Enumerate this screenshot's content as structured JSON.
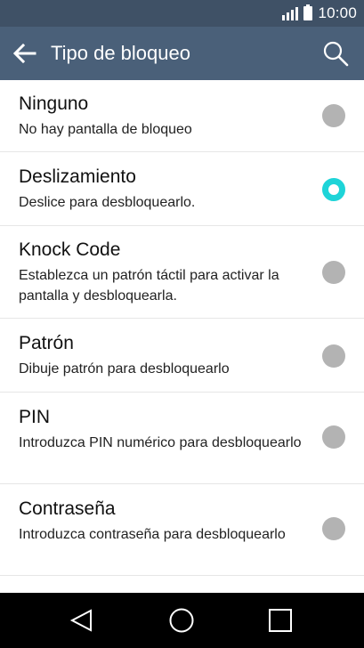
{
  "status_bar": {
    "time": "10:00",
    "icons": [
      "signal-icon",
      "battery-icon"
    ]
  },
  "app_bar": {
    "title": "Tipo de bloqueo",
    "back_icon": "arrow-left-icon",
    "search_icon": "search-icon"
  },
  "options": [
    {
      "title": "Ninguno",
      "subtitle": "No hay pantalla de bloqueo",
      "selected": false
    },
    {
      "title": "Deslizamiento",
      "subtitle": "Deslice para desbloquearlo.",
      "selected": true
    },
    {
      "title": "Knock Code",
      "subtitle": "Establezca un patrón táctil para activar la pantalla y desbloquearla.",
      "selected": false
    },
    {
      "title": "Patrón",
      "subtitle": "Dibuje patrón para desbloquearlo",
      "selected": false
    },
    {
      "title": "PIN",
      "subtitle": "Introduzca PIN numérico para desbloquearlo",
      "selected": false
    },
    {
      "title": "Contraseña",
      "subtitle": "Introduzca contraseña para desbloquearlo",
      "selected": false
    }
  ],
  "nav_bar": {
    "icons": [
      "back-triangle-icon",
      "home-circle-icon",
      "recents-square-icon"
    ]
  },
  "colors": {
    "status_bar": "#3f5166",
    "app_bar": "#4a6079",
    "accent": "#1ed4d8",
    "radio_off": "#b3b3b3"
  }
}
